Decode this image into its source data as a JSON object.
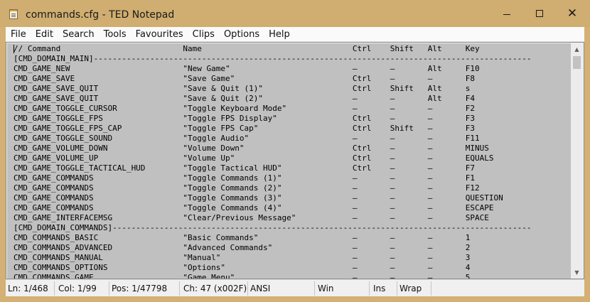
{
  "window": {
    "title": "commands.cfg - TED Notepad",
    "icon": "notepad-icon",
    "minimize_label": "",
    "maximize_label": "",
    "close_label": "✕"
  },
  "menu": [
    "File",
    "Edit",
    "Search",
    "Tools",
    "Favourites",
    "Clips",
    "Options",
    "Help"
  ],
  "editor": {
    "lines": [
      "// Command                          Name                                Ctrl    Shift   Alt     Key",
      "[CMD_DOMAIN_MAIN]---------------------------------------------------------------------------------------------",
      "CMD_GAME_NEW                        \"New Game\"                          –       –       Alt     F10",
      "CMD_GAME_SAVE                       \"Save Game\"                         Ctrl    –       –       F8",
      "CMD_GAME_SAVE_QUIT                  \"Save & Quit (1)\"                   Ctrl    Shift   Alt     s",
      "CMD_GAME_SAVE_QUIT                  \"Save & Quit (2)\"                   –       –       Alt     F4",
      "CMD_GAME_TOGGLE_CURSOR              \"Toggle Keyboard Mode\"              –       –       –       F2",
      "CMD_GAME_TOGGLE_FPS                 \"Toggle FPS Display\"                Ctrl    –       –       F3",
      "CMD_GAME_TOGGLE_FPS_CAP             \"Toggle FPS Cap\"                    Ctrl    Shift   –       F3",
      "CMD_GAME_TOGGLE_SOUND               \"Toggle Audio\"                      –       –       –       F11",
      "CMD_GAME_VOLUME_DOWN                \"Volume Down\"                       Ctrl    –       –       MINUS",
      "CMD_GAME_VOLUME_UP                  \"Volume Up\"                         Ctrl    –       –       EQUALS",
      "CMD_GAME_TOGGLE_TACTICAL_HUD        \"Toggle Tactical HUD\"               Ctrl    –       –       F7",
      "CMD_GAME_COMMANDS                   \"Toggle Commands (1)\"               –       –       –       F1",
      "CMD_GAME_COMMANDS                   \"Toggle Commands (2)\"               –       –       –       F12",
      "CMD_GAME_COMMANDS                   \"Toggle Commands (3)\"               –       –       –       QUESTION",
      "CMD_GAME_COMMANDS                   \"Toggle Commands (4)\"               –       –       –       ESCAPE",
      "CMD_GAME_INTERFACEMSG               \"Clear/Previous Message\"            –       –       –       SPACE",
      "[CMD_DOMAIN_COMMANDS]-----------------------------------------------------------------------------------------",
      "CMD_COMMANDS_BASIC                  \"Basic Commands\"                    –       –       –       1",
      "CMD_COMMANDS_ADVANCED               \"Advanced Commands\"                 –       –       –       2",
      "CMD_COMMANDS_MANUAL                 \"Manual\"                            –       –       –       3",
      "CMD_COMMANDS_OPTIONS                \"Options\"                           –       –       –       4",
      "CMD_COMMANDS_GAME                   \"Game Menu\"                         –       –       –       5"
    ]
  },
  "scrollbar": {
    "up_icon": "▲",
    "down_icon": "▼"
  },
  "status": {
    "line": "Ln: 1/468",
    "col": "Col: 1/99",
    "pos": "Pos: 1/47798",
    "ch": "Ch: 47 (x002F)",
    "encoding": "ANSI",
    "eol": "Win",
    "ins": "Ins",
    "wrap": "Wrap"
  }
}
